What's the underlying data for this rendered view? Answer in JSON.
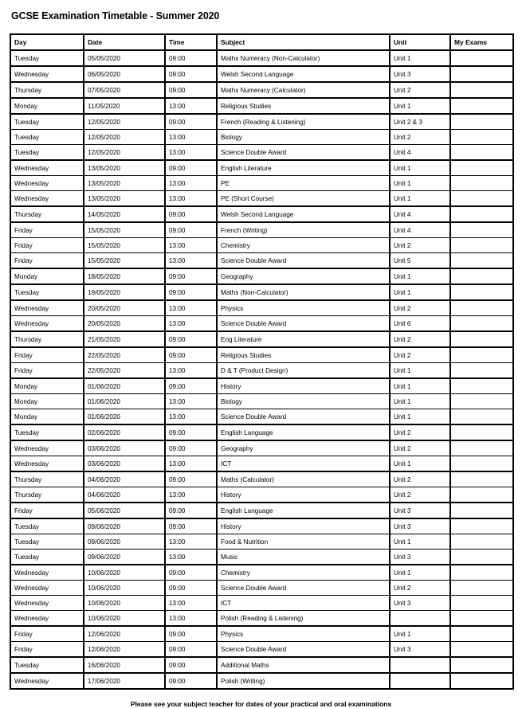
{
  "document": {
    "title": "GCSE Examination Timetable - Summer 2020",
    "footer_note": "Please see your subject teacher for dates of your practical and oral examinations"
  },
  "table": {
    "columns": [
      {
        "key": "day",
        "label": "Day"
      },
      {
        "key": "date",
        "label": "Date"
      },
      {
        "key": "time",
        "label": "Time"
      },
      {
        "key": "subject",
        "label": "Subject"
      },
      {
        "key": "unit",
        "label": "Unit"
      },
      {
        "key": "my_exams",
        "label": "My Exams"
      }
    ],
    "rows": [
      {
        "day": "Tuesday",
        "date": "05/05/2020",
        "time": "09:00",
        "subject": "Maths Numeracy (Non-Calculator)",
        "unit": "Unit 1",
        "my_exams": "",
        "group_start": true
      },
      {
        "day": "Wednesday",
        "date": "06/05/2020",
        "time": "09:00",
        "subject": "Welsh Second Language",
        "unit": "Unit 3",
        "my_exams": "",
        "group_start": true
      },
      {
        "day": "Thursday",
        "date": "07/05/2020",
        "time": "09:00",
        "subject": "Maths Numeracy (Calculator)",
        "unit": "Unit 2",
        "my_exams": "",
        "group_start": true
      },
      {
        "day": "Monday",
        "date": "11/05/2020",
        "time": "13:00",
        "subject": "Religious Studies",
        "unit": "Unit 1",
        "my_exams": "",
        "group_start": true
      },
      {
        "day": "Tuesday",
        "date": "12/05/2020",
        "time": "09:00",
        "subject": "French (Reading & Listening)",
        "unit": "Unit 2 & 3",
        "my_exams": "",
        "group_start": true
      },
      {
        "day": "Tuesday",
        "date": "12/05/2020",
        "time": "13:00",
        "subject": "Biology",
        "unit": "Unit 2",
        "my_exams": "",
        "group_start": false
      },
      {
        "day": "Tuesday",
        "date": "12/05/2020",
        "time": "13:00",
        "subject": "Science Double Award",
        "unit": "Unit 4",
        "my_exams": "",
        "group_start": false
      },
      {
        "day": "Wednesday",
        "date": "13/05/2020",
        "time": "09:00",
        "subject": "English Literature",
        "unit": "Unit 1",
        "my_exams": "",
        "group_start": true
      },
      {
        "day": "Wednesday",
        "date": "13/05/2020",
        "time": "13:00",
        "subject": "PE",
        "unit": "Unit 1",
        "my_exams": "",
        "group_start": false
      },
      {
        "day": "Wednesday",
        "date": "13/05/2020",
        "time": "13:00",
        "subject": "PE (Short Course)",
        "unit": "Unit 1",
        "my_exams": "",
        "group_start": false
      },
      {
        "day": "Thursday",
        "date": "14/05/2020",
        "time": "09:00",
        "subject": "Welsh Second Language",
        "unit": "Unit 4",
        "my_exams": "",
        "group_start": true
      },
      {
        "day": "Friday",
        "date": "15/05/2020",
        "time": "09:00",
        "subject": "French (Writing)",
        "unit": "Unit 4",
        "my_exams": "",
        "group_start": true
      },
      {
        "day": "Friday",
        "date": "15/05/2020",
        "time": "13:00",
        "subject": "Chemistry",
        "unit": "Unit 2",
        "my_exams": "",
        "group_start": false
      },
      {
        "day": "Friday",
        "date": "15/05/2020",
        "time": "13:00",
        "subject": "Science Double Award",
        "unit": "Unit 5",
        "my_exams": "",
        "group_start": false
      },
      {
        "day": "Monday",
        "date": "18/05/2020",
        "time": "09:00",
        "subject": "Geography",
        "unit": "Unit 1",
        "my_exams": "",
        "group_start": true
      },
      {
        "day": "Tuesday",
        "date": "19/05/2020",
        "time": "09:00",
        "subject": "Maths (Non-Calculator)",
        "unit": "Unit 1",
        "my_exams": "",
        "group_start": true
      },
      {
        "day": "Wednesday",
        "date": "20/05/2020",
        "time": "13:00",
        "subject": "Physics",
        "unit": "Unit 2",
        "my_exams": "",
        "group_start": true
      },
      {
        "day": "Wednesday",
        "date": "20/05/2020",
        "time": "13:00",
        "subject": "Science Double Award",
        "unit": "Unit 6",
        "my_exams": "",
        "group_start": false
      },
      {
        "day": "Thursday",
        "date": "21/05/2020",
        "time": "09:00",
        "subject": "Eng Literature",
        "unit": "Unit 2",
        "my_exams": "",
        "group_start": true
      },
      {
        "day": "Friday",
        "date": "22/05/2020",
        "time": "09:00",
        "subject": "Religious Studies",
        "unit": "Unit 2",
        "my_exams": "",
        "group_start": true
      },
      {
        "day": "Friday",
        "date": "22/05/2020",
        "time": "13:00",
        "subject": "D & T (Product Design)",
        "unit": "Unit 1",
        "my_exams": "",
        "group_start": false
      },
      {
        "day": "Monday",
        "date": "01/06/2020",
        "time": "09:00",
        "subject": "History",
        "unit": "Unit 1",
        "my_exams": "",
        "group_start": true
      },
      {
        "day": "Monday",
        "date": "01/06/2020",
        "time": "13:00",
        "subject": "Biology",
        "unit": "Unit 1",
        "my_exams": "",
        "group_start": false
      },
      {
        "day": "Monday",
        "date": "01/06/2020",
        "time": "13:00",
        "subject": "Science Double Award",
        "unit": "Unit 1",
        "my_exams": "",
        "group_start": false
      },
      {
        "day": "Tuesday",
        "date": "02/06/2020",
        "time": "09:00",
        "subject": "English Language",
        "unit": "Unit 2",
        "my_exams": "",
        "group_start": true
      },
      {
        "day": "Wednesday",
        "date": "03/06/2020",
        "time": "09:00",
        "subject": "Geography",
        "unit": "Unit 2",
        "my_exams": "",
        "group_start": true
      },
      {
        "day": "Wednesday",
        "date": "03/06/2020",
        "time": "13:00",
        "subject": "ICT",
        "unit": "Unit 1",
        "my_exams": "",
        "group_start": false
      },
      {
        "day": "Thursday",
        "date": "04/06/2020",
        "time": "09:00",
        "subject": "Maths (Calculator)",
        "unit": "Unit 2",
        "my_exams": "",
        "group_start": true
      },
      {
        "day": "Thursday",
        "date": "04/06/2020",
        "time": "13:00",
        "subject": "History",
        "unit": "Unit 2",
        "my_exams": "",
        "group_start": false
      },
      {
        "day": "Friday",
        "date": "05/06/2020",
        "time": "09:00",
        "subject": "English Language",
        "unit": "Unit 3",
        "my_exams": "",
        "group_start": true
      },
      {
        "day": "Tuesday",
        "date": "09/06/2020",
        "time": "09:00",
        "subject": "History",
        "unit": "Unit 3",
        "my_exams": "",
        "group_start": true
      },
      {
        "day": "Tuesday",
        "date": "09/06/2020",
        "time": "13:00",
        "subject": "Food & Nutrition",
        "unit": "Unit 1",
        "my_exams": "",
        "group_start": false
      },
      {
        "day": "Tuesday",
        "date": "09/06/2020",
        "time": "13:00",
        "subject": "Music",
        "unit": "Unit 3",
        "my_exams": "",
        "group_start": false
      },
      {
        "day": "Wednesday",
        "date": "10/06/2020",
        "time": "09:00",
        "subject": "Chemistry",
        "unit": "Unit 1",
        "my_exams": "",
        "group_start": true
      },
      {
        "day": "Wednesday",
        "date": "10/06/2020",
        "time": "09:00",
        "subject": "Science Double Award",
        "unit": "Unit 2",
        "my_exams": "",
        "group_start": false
      },
      {
        "day": "Wednesday",
        "date": "10/06/2020",
        "time": "13:00",
        "subject": "ICT",
        "unit": "Unit 3",
        "my_exams": "",
        "group_start": false
      },
      {
        "day": "Wednesday",
        "date": "10/06/2020",
        "time": "13:00",
        "subject": "Polish (Reading & Listening)",
        "unit": "",
        "my_exams": "",
        "group_start": false
      },
      {
        "day": "Friday",
        "date": "12/06/2020",
        "time": "09:00",
        "subject": "Physics",
        "unit": "Unit 1",
        "my_exams": "",
        "group_start": true
      },
      {
        "day": "Friday",
        "date": "12/06/2020",
        "time": "09:00",
        "subject": "Science Double Award",
        "unit": "Unit 3",
        "my_exams": "",
        "group_start": false
      },
      {
        "day": "Tuesday",
        "date": "16/06/2020",
        "time": "09:00",
        "subject": "Additional Maths",
        "unit": "",
        "my_exams": "",
        "group_start": true
      },
      {
        "day": "Wednesday",
        "date": "17/06/2020",
        "time": "09:00",
        "subject": "Polish (Writing)",
        "unit": "",
        "my_exams": "",
        "group_start": true
      }
    ]
  }
}
